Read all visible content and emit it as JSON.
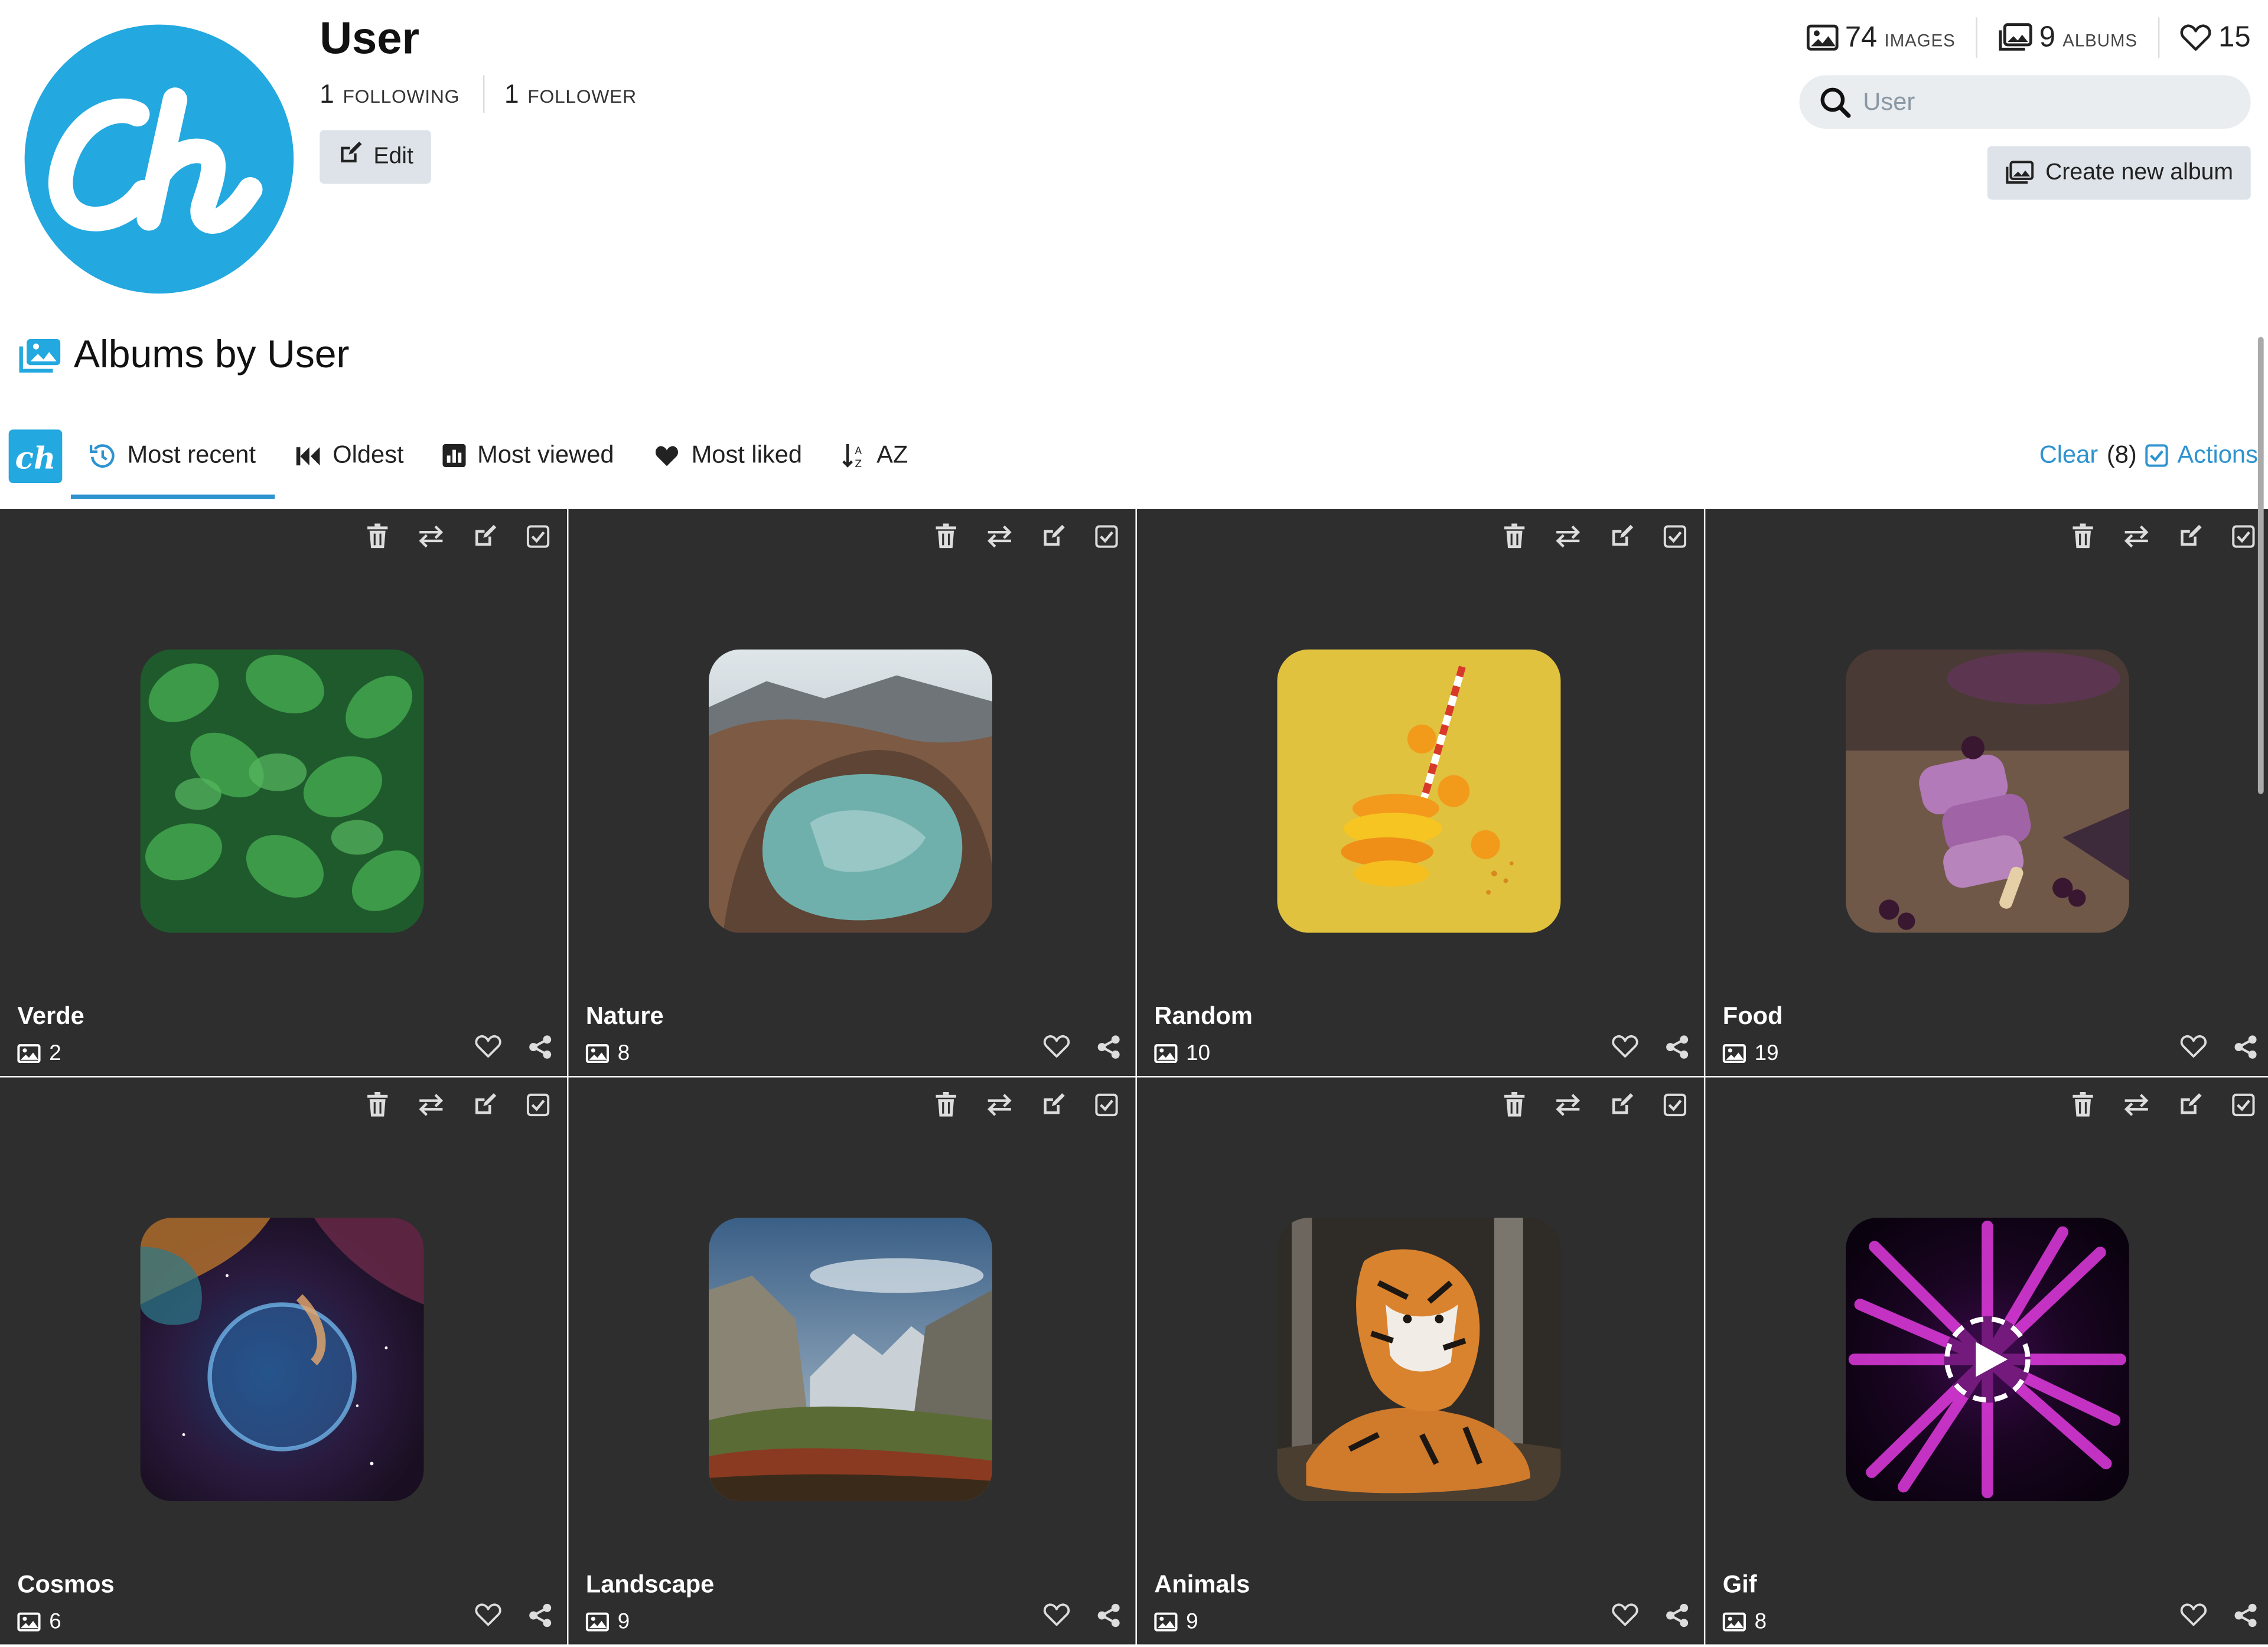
{
  "profile": {
    "username": "User",
    "following_count": "1",
    "following_label": "FOLLOWING",
    "followers_count": "1",
    "followers_label": "FOLLOWER",
    "edit_label": "Edit"
  },
  "stats": {
    "images_count": "74",
    "images_label": "IMAGES",
    "albums_count": "9",
    "albums_label": "ALBUMS",
    "likes_count": "15"
  },
  "search": {
    "placeholder": "User",
    "value": ""
  },
  "create_album_label": "Create new album",
  "section_title": "Albums by User",
  "tabs": [
    {
      "label": "Most recent",
      "icon": "history-icon"
    },
    {
      "label": "Oldest",
      "icon": "backward-icon"
    },
    {
      "label": "Most viewed",
      "icon": "chart-icon"
    },
    {
      "label": "Most liked",
      "icon": "heart-icon"
    },
    {
      "label": "AZ",
      "icon": "sort-alpha-icon"
    }
  ],
  "actions": {
    "clear_label": "Clear",
    "selected_count": "(8)",
    "actions_label": "Actions"
  },
  "albums": [
    {
      "name": "Verde",
      "count": "2"
    },
    {
      "name": "Nature",
      "count": "8"
    },
    {
      "name": "Random",
      "count": "10"
    },
    {
      "name": "Food",
      "count": "19"
    },
    {
      "name": "Cosmos",
      "count": "6"
    },
    {
      "name": "Landscape",
      "count": "9"
    },
    {
      "name": "Animals",
      "count": "9"
    },
    {
      "name": "Gif",
      "count": "8"
    }
  ],
  "colors": {
    "brand": "#23a8e0",
    "accent_link": "#2e93cf",
    "card_bg": "#2e2e2e",
    "button_bg": "#dde3e8"
  }
}
